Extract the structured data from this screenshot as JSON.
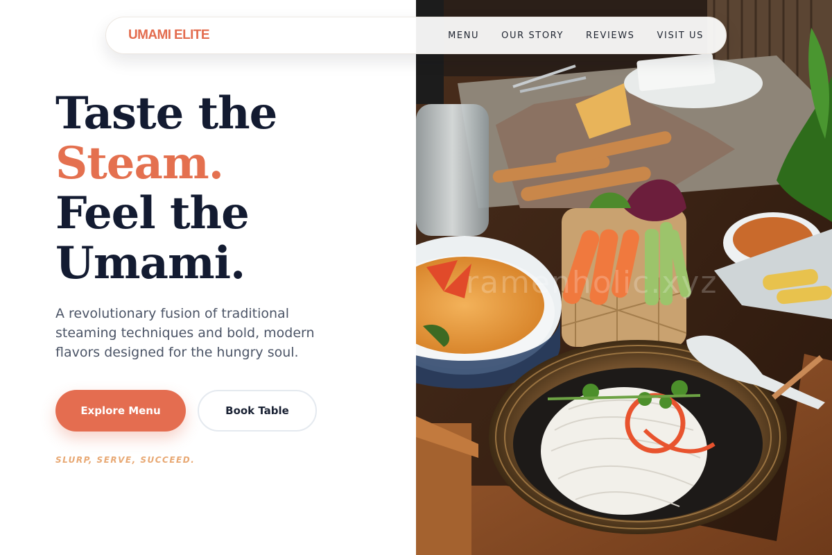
{
  "brand": {
    "name": "UMAMI ELITE"
  },
  "nav": {
    "items": [
      {
        "label": "MENU"
      },
      {
        "label": "OUR STORY"
      },
      {
        "label": "REVIEWS"
      },
      {
        "label": "VISIT US"
      }
    ]
  },
  "hero": {
    "line1": "Taste the",
    "line2": "Steam.",
    "line3": "Feel the",
    "line4": "Umami.",
    "subtitle": "A revolutionary fusion of traditional steaming techniques and bold, modern flavors designed for the hungry soul.",
    "primary_cta": "Explore Menu",
    "secondary_cta": "Book Table",
    "tagline": "SLURP, SERVE, SUCCEED."
  },
  "photo": {
    "watermark": "ramenholic.xyz"
  },
  "colors": {
    "accent": "#e4704f",
    "heading": "#131b31",
    "body_text": "#4b5466",
    "tagline": "#e8a873"
  }
}
